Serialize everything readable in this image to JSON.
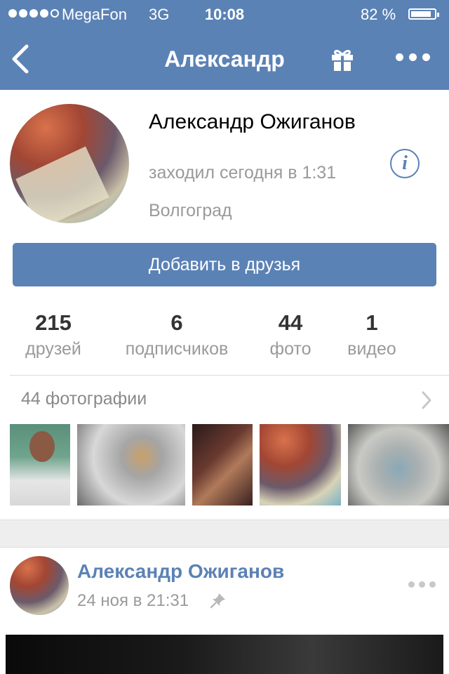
{
  "status_bar": {
    "carrier": "MegaFon",
    "network": "3G",
    "time": "10:08",
    "battery": "82 %"
  },
  "nav": {
    "title": "Александр",
    "back_icon": "chevron-left-icon",
    "gift_icon": "gift-icon",
    "more_icon": "more-horizontal-icon"
  },
  "profile": {
    "name": "Александр Ожиганов",
    "last_seen": "заходил сегодня в 1:31",
    "city": "Волгоград",
    "info_icon": "i",
    "add_friend_label": "Добавить в друзья"
  },
  "counters": [
    {
      "value": "215",
      "label": "друзей"
    },
    {
      "value": "6",
      "label": "подписчиков"
    },
    {
      "value": "44",
      "label": "фото"
    },
    {
      "value": "1",
      "label": "видео"
    }
  ],
  "photos": {
    "header": "44 фотографии"
  },
  "post": {
    "author": "Александр Ожиганов",
    "date": "24 ноя в 21:31"
  },
  "colors": {
    "brand": "#5b82b5",
    "muted_text": "#9a9a9a"
  }
}
